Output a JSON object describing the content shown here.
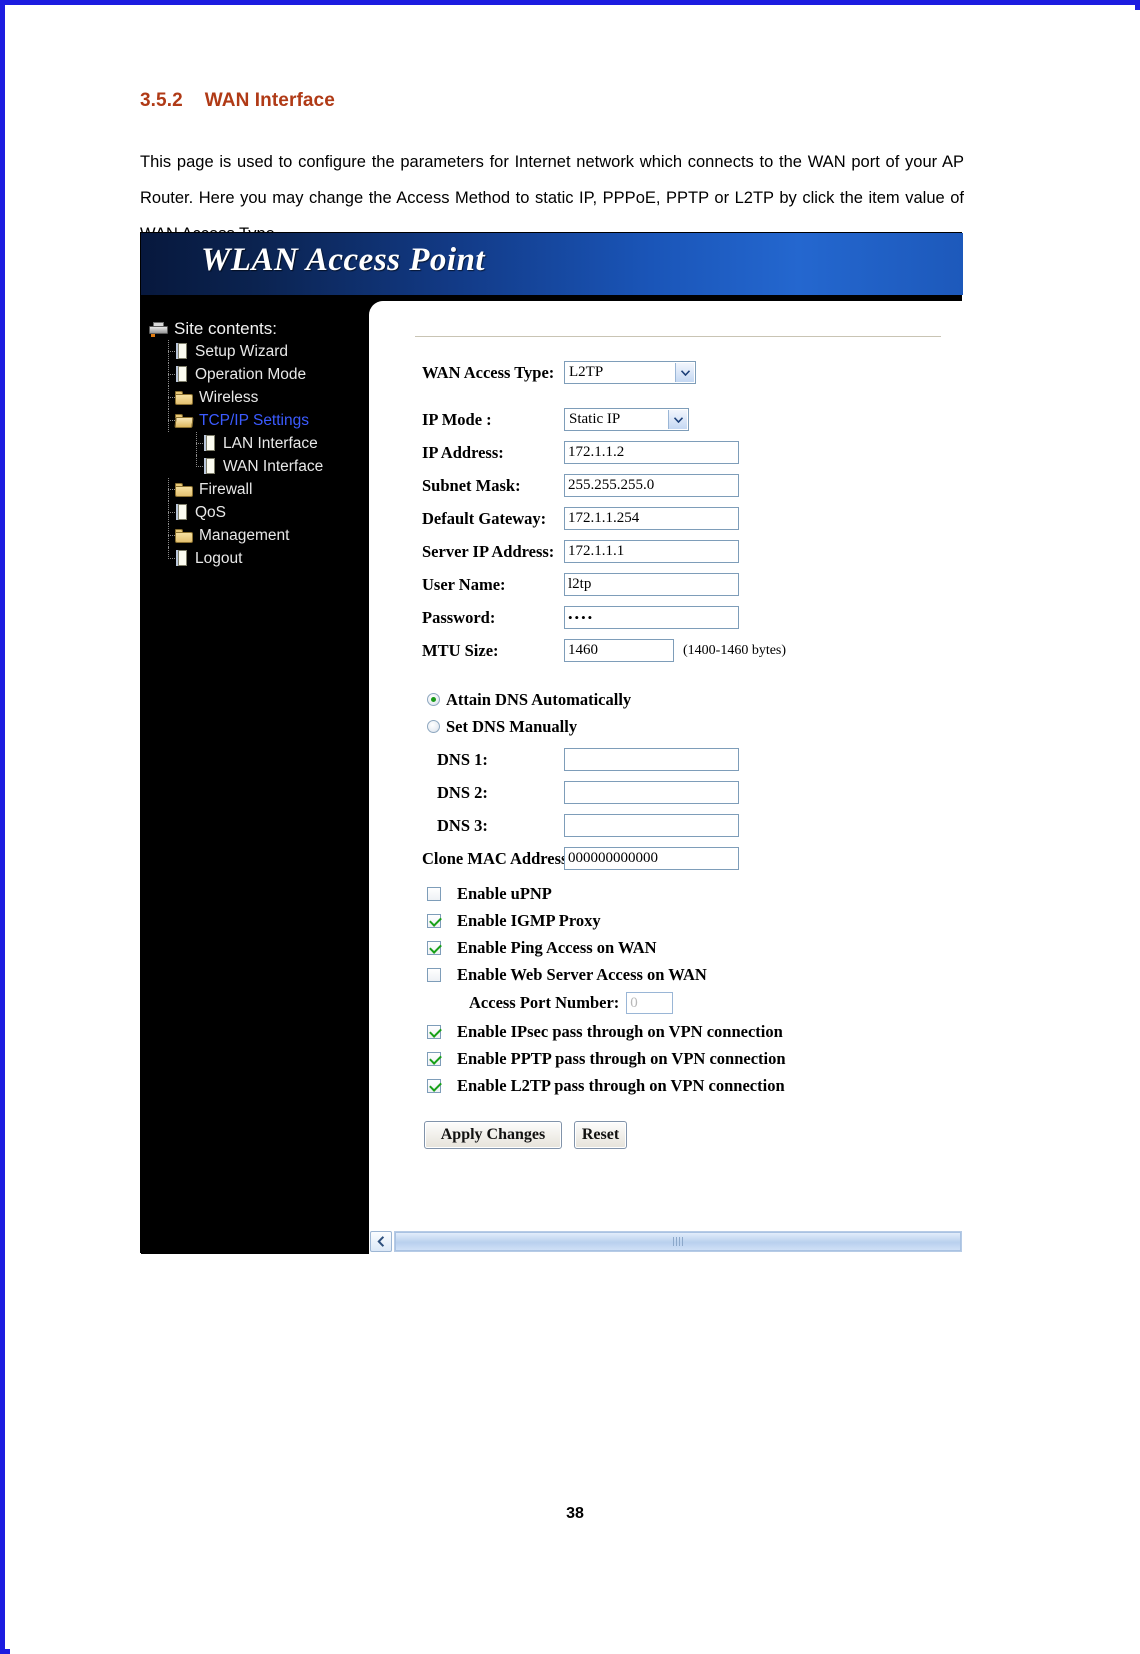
{
  "document": {
    "section_number": "3.5.2",
    "section_title": "WAN Interface",
    "paragraph": "This page is used to configure the parameters for Internet network which connects to the WAN port of your AP Router. Here you may change the Access Method to static IP, PPPoE, PPTP or L2TP by click the item value of WAN Access Type.",
    "page_number": "38"
  },
  "router_ui": {
    "banner_title": "WLAN Access Point",
    "sidebar": {
      "root_label": "Site contents:",
      "items": [
        {
          "label": "Setup Wizard",
          "icon": "document-icon",
          "level": 1,
          "active": false
        },
        {
          "label": "Operation Mode",
          "icon": "document-icon",
          "level": 1,
          "active": false
        },
        {
          "label": "Wireless",
          "icon": "folder-icon",
          "level": 1,
          "active": false
        },
        {
          "label": "TCP/IP Settings",
          "icon": "folder-open-icon",
          "level": 1,
          "active": true
        },
        {
          "label": "LAN Interface",
          "icon": "document-icon",
          "level": 2,
          "active": false
        },
        {
          "label": "WAN Interface",
          "icon": "document-icon",
          "level": 2,
          "active": false
        },
        {
          "label": "Firewall",
          "icon": "folder-icon",
          "level": 1,
          "active": false
        },
        {
          "label": "QoS",
          "icon": "document-icon",
          "level": 1,
          "active": false
        },
        {
          "label": "Management",
          "icon": "folder-icon",
          "level": 1,
          "active": false
        },
        {
          "label": "Logout",
          "icon": "document-icon",
          "level": 1,
          "active": false
        }
      ]
    },
    "form": {
      "wan_access_type": {
        "label": "WAN Access Type:",
        "value": "L2TP"
      },
      "ip_mode": {
        "label": "IP Mode :",
        "value": "Static IP"
      },
      "ip_address": {
        "label": "IP Address:",
        "value": "172.1.1.2"
      },
      "subnet_mask": {
        "label": "Subnet Mask:",
        "value": "255.255.255.0"
      },
      "default_gateway": {
        "label": "Default Gateway:",
        "value": "172.1.1.254"
      },
      "server_ip_address": {
        "label": "Server IP Address:",
        "value": "172.1.1.1"
      },
      "user_name": {
        "label": "User Name:",
        "value": "l2tp"
      },
      "password": {
        "label": "Password:",
        "value": "••••"
      },
      "mtu_size": {
        "label": "MTU Size:",
        "value": "1460",
        "hint": "(1400-1460 bytes)"
      },
      "dns_auto": {
        "label": "Attain DNS Automatically",
        "checked": true
      },
      "dns_manual": {
        "label": "Set DNS Manually",
        "checked": false
      },
      "dns1": {
        "label": "DNS 1:",
        "value": ""
      },
      "dns2": {
        "label": "DNS 2:",
        "value": ""
      },
      "dns3": {
        "label": "DNS 3:",
        "value": ""
      },
      "clone_mac": {
        "label": "Clone MAC Address:",
        "value": "000000000000"
      },
      "checkboxes": [
        {
          "label": "Enable uPNP",
          "checked": false
        },
        {
          "label": "Enable IGMP Proxy",
          "checked": true
        },
        {
          "label": "Enable Ping Access on WAN",
          "checked": true
        },
        {
          "label": "Enable Web Server Access on WAN",
          "checked": false
        }
      ],
      "access_port": {
        "label": "Access Port Number:",
        "value": "0"
      },
      "vpn_checkboxes": [
        {
          "label": "Enable IPsec pass through on VPN connection",
          "checked": true
        },
        {
          "label": "Enable PPTP pass through on VPN connection",
          "checked": true
        },
        {
          "label": "Enable L2TP pass through on VPN connection",
          "checked": true
        }
      ],
      "apply_button": "Apply Changes",
      "reset_button": "Reset"
    }
  }
}
